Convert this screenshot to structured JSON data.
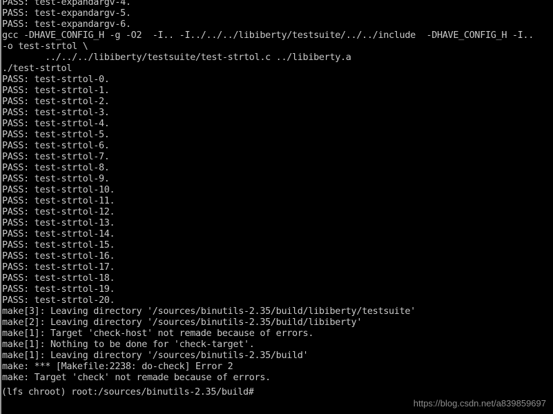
{
  "terminal": {
    "background_color": "#000000",
    "text_color": "#c9c9c9",
    "window_edge_color": "#9a9a9a",
    "lines": [
      "PASS: test-expandargv-4.",
      "PASS: test-expandargv-5.",
      "PASS: test-expandargv-6.",
      "gcc -DHAVE_CONFIG_H -g -O2  -I.. -I../../../libiberty/testsuite/../../include  -DHAVE_CONFIG_H -I..",
      "-o test-strtol \\",
      "        ../../../libiberty/testsuite/test-strtol.c ../libiberty.a",
      "./test-strtol",
      "PASS: test-strtol-0.",
      "PASS: test-strtol-1.",
      "PASS: test-strtol-2.",
      "PASS: test-strtol-3.",
      "PASS: test-strtol-4.",
      "PASS: test-strtol-5.",
      "PASS: test-strtol-6.",
      "PASS: test-strtol-7.",
      "PASS: test-strtol-8.",
      "PASS: test-strtol-9.",
      "PASS: test-strtol-10.",
      "PASS: test-strtol-11.",
      "PASS: test-strtol-12.",
      "PASS: test-strtol-13.",
      "PASS: test-strtol-14.",
      "PASS: test-strtol-15.",
      "PASS: test-strtol-16.",
      "PASS: test-strtol-17.",
      "PASS: test-strtol-18.",
      "PASS: test-strtol-19.",
      "PASS: test-strtol-20.",
      "make[3]: Leaving directory '/sources/binutils-2.35/build/libiberty/testsuite'",
      "make[2]: Leaving directory '/sources/binutils-2.35/build/libiberty'",
      "make[1]: Target 'check-host' not remade because of errors.",
      "make[1]: Nothing to be done for 'check-target'.",
      "make[1]: Leaving directory '/sources/binutils-2.35/build'",
      "make: *** [Makefile:2238: do-check] Error 2",
      "make: Target 'check' not remade because of errors."
    ],
    "prompt": "(lfs chroot) root:/sources/binutils-2.35/build#"
  },
  "watermark": {
    "text": "https://blog.csdn.net/a839859697",
    "color": "#8e8e8e"
  }
}
